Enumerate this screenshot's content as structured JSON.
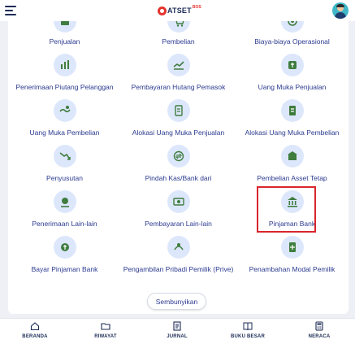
{
  "header": {
    "logo_text": "OATSETBOS",
    "logo_sup": "BOS"
  },
  "menu": {
    "items": [
      {
        "label": "Penjualan",
        "icon": "sales-icon"
      },
      {
        "label": "Pembelian",
        "icon": "purchase-icon"
      },
      {
        "label": "Biaya-biaya Operasional",
        "icon": "operational-cost-icon"
      },
      {
        "label": "Penerimaan Piutang Pelanggan",
        "icon": "receivable-icon"
      },
      {
        "label": "Pembayaran Hutang Pemasok",
        "icon": "payable-icon"
      },
      {
        "label": "Uang Muka Penjualan",
        "icon": "sales-advance-icon"
      },
      {
        "label": "Uang Muka Pembelian",
        "icon": "purchase-advance-icon"
      },
      {
        "label": "Alokasi Uang Muka Penjualan",
        "icon": "sales-advance-allocation-icon"
      },
      {
        "label": "Alokasi Uang Muka Pembelian",
        "icon": "purchase-advance-allocation-icon"
      },
      {
        "label": "Penyusutan",
        "icon": "depreciation-icon"
      },
      {
        "label": "Pindah Kas/Bank dari",
        "icon": "cash-transfer-icon"
      },
      {
        "label": "Pembelian Asset Tetap",
        "icon": "fixed-asset-icon"
      },
      {
        "label": "Penerimaan Lain-lain",
        "icon": "other-receipt-icon"
      },
      {
        "label": "Pembayaran Lain-lain",
        "icon": "other-payment-icon"
      },
      {
        "label": "Pinjaman Bank",
        "icon": "bank-loan-icon"
      },
      {
        "label": "Bayar Pinjaman Bank",
        "icon": "pay-bank-loan-icon"
      },
      {
        "label": "Pengambilan Pribadi Pemilik (Prive)",
        "icon": "owner-withdrawal-icon"
      },
      {
        "label": "Penambahan Modal Pemilik",
        "icon": "owner-capital-icon"
      }
    ],
    "toggle_label": "Sembunyikan"
  },
  "bottom_nav": [
    {
      "label": "BERANDA",
      "icon": "home-icon"
    },
    {
      "label": "RIWAYAT",
      "icon": "folder-icon"
    },
    {
      "label": "JURNAL",
      "icon": "journal-icon"
    },
    {
      "label": "BUKU BESAR",
      "icon": "ledger-book-icon"
    },
    {
      "label": "NERACA",
      "icon": "calculator-icon"
    }
  ],
  "colors": {
    "accent": "#2b3a8f",
    "icon_bg": "#dde7fb",
    "icon_fg": "#3f7d3f",
    "highlight": "#d9262c"
  }
}
